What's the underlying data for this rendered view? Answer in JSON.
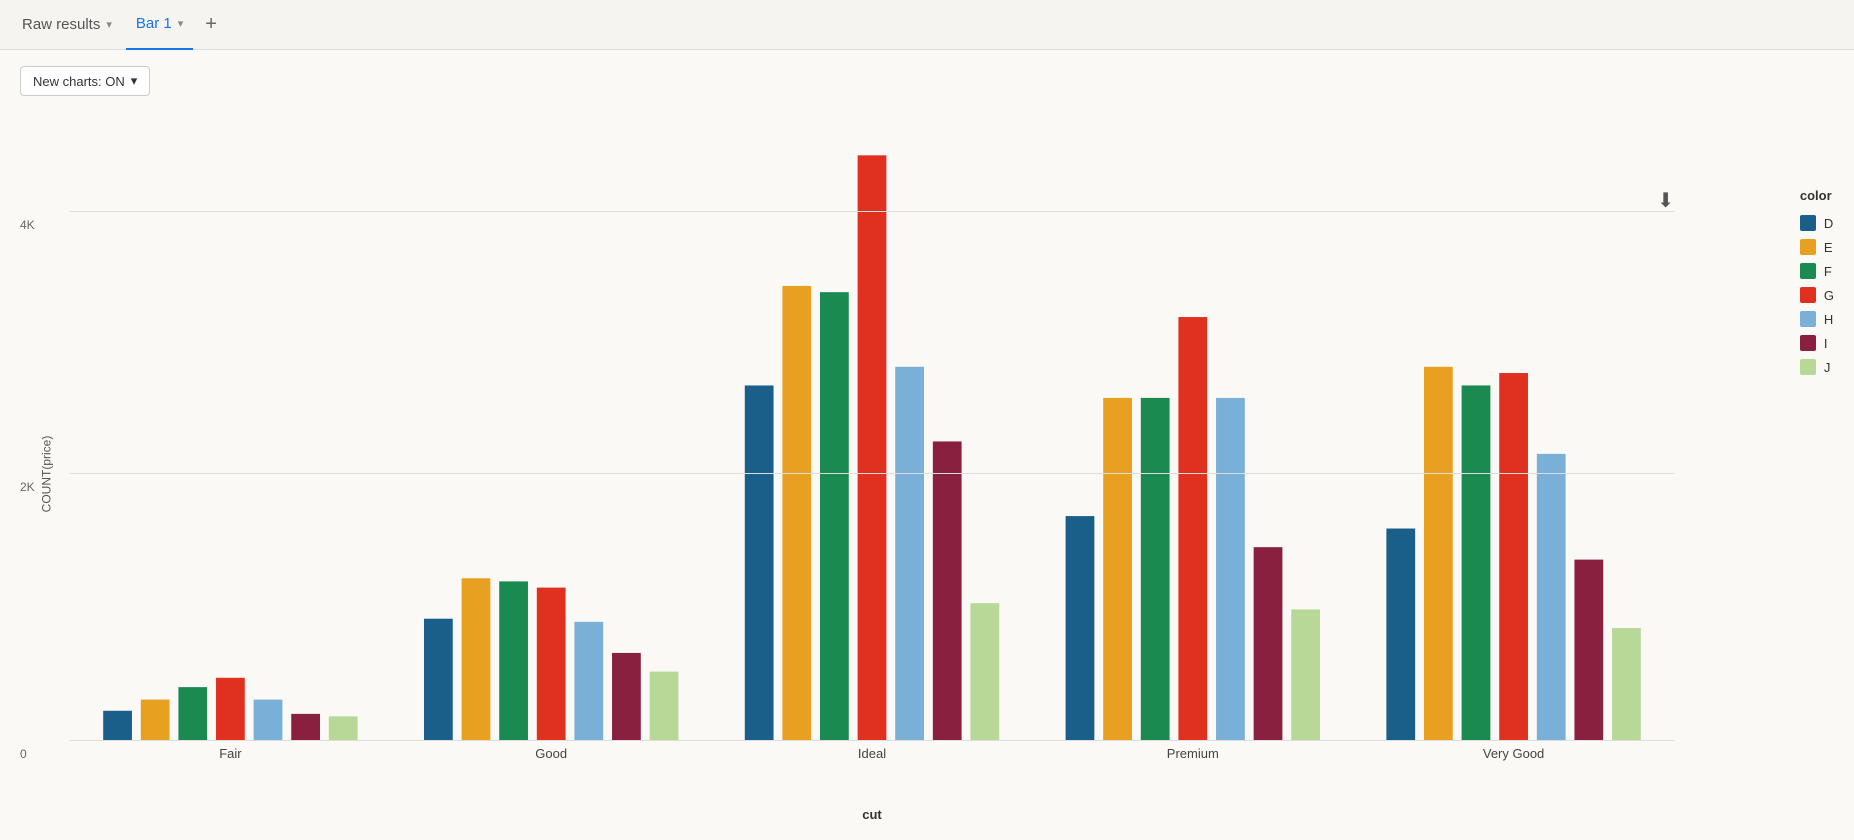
{
  "tabs": [
    {
      "id": "raw-results",
      "label": "Raw results",
      "active": false,
      "has_chevron": true
    },
    {
      "id": "bar1",
      "label": "Bar 1",
      "active": true,
      "has_chevron": true
    }
  ],
  "tab_add_label": "+",
  "toolbar": {
    "new_charts_label": "New charts: ON",
    "chevron": "▾"
  },
  "legend": {
    "title": "color",
    "items": [
      {
        "label": "D",
        "color": "#1a5f8a"
      },
      {
        "label": "E",
        "color": "#e8a020"
      },
      {
        "label": "F",
        "color": "#1a8a50"
      },
      {
        "label": "G",
        "color": "#e03020"
      },
      {
        "label": "H",
        "color": "#7ab0d8"
      },
      {
        "label": "I",
        "color": "#8a2040"
      },
      {
        "label": "J",
        "color": "#b8d898"
      }
    ]
  },
  "yaxis": {
    "label": "COUNT(price)",
    "ticks": [
      {
        "value": "0",
        "pct": 0
      },
      {
        "value": "2K",
        "pct": 38.5
      },
      {
        "value": "4K",
        "pct": 77
      }
    ]
  },
  "xaxis": {
    "title": "cut",
    "labels": [
      "Fair",
      "Good",
      "Ideal",
      "Premium",
      "Very Good"
    ]
  },
  "bars": {
    "colors": [
      "#1a5f8a",
      "#e8a020",
      "#1a8a50",
      "#e03020",
      "#7ab0d8",
      "#8a2040",
      "#b8d898"
    ],
    "groups": [
      {
        "name": "Fair",
        "values": [
          0.047,
          0.065,
          0.085,
          0.1,
          0.065,
          0.042,
          0.038
        ]
      },
      {
        "name": "Good",
        "values": [
          0.195,
          0.26,
          0.255,
          0.245,
          0.19,
          0.14,
          0.11
        ]
      },
      {
        "name": "Ideal",
        "values": [
          0.57,
          0.73,
          0.72,
          0.94,
          0.6,
          0.48,
          0.22
        ]
      },
      {
        "name": "Premium",
        "values": [
          0.36,
          0.55,
          0.55,
          0.68,
          0.55,
          0.31,
          0.21
        ]
      },
      {
        "name": "Very Good",
        "values": [
          0.34,
          0.6,
          0.57,
          0.59,
          0.46,
          0.29,
          0.18
        ]
      }
    ]
  }
}
